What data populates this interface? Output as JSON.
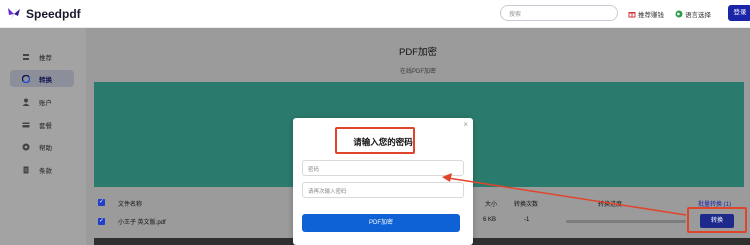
{
  "brand": {
    "name": "Speedpdf",
    "accent": "#1a25a8"
  },
  "header": {
    "search_placeholder": "搜索",
    "referral_label": "推荐赚钱",
    "language_label": "语言选择",
    "login_label": "登录"
  },
  "sidebar": {
    "items": [
      {
        "label": "推荐",
        "icon": "layers-icon"
      },
      {
        "label": "转换",
        "icon": "convert-icon",
        "active": true
      },
      {
        "label": "账户",
        "icon": "user-icon"
      },
      {
        "label": "套餐",
        "icon": "card-icon"
      },
      {
        "label": "帮助",
        "icon": "help-icon"
      },
      {
        "label": "条款",
        "icon": "document-icon"
      }
    ]
  },
  "main": {
    "title": "PDF加密",
    "subtitle": "在线PDF加密"
  },
  "table": {
    "headers": {
      "filename": "文件名称",
      "size": "大小",
      "count": "转换次数",
      "progress": "转换进度",
      "batch": "批量转换 (1)"
    },
    "rows": [
      {
        "filename": "小王子 英文版.pdf",
        "size": "6 KB",
        "count": "-1",
        "action": "转换"
      }
    ]
  },
  "modal": {
    "title": "请输入您的密码",
    "password_placeholder": "密码",
    "confirm_placeholder": "请再次输入密码",
    "submit_label": "PDF加密",
    "close": "×"
  },
  "annotation_color": "#e0452c"
}
